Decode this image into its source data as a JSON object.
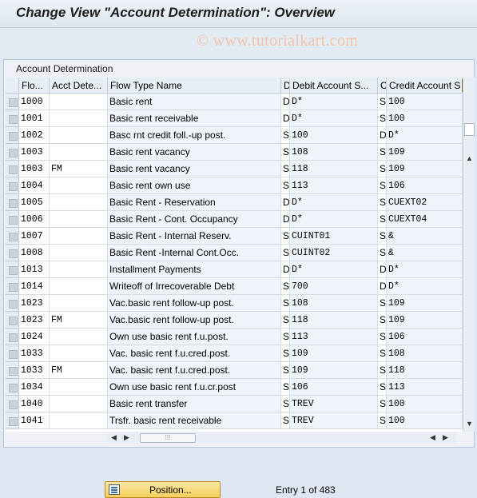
{
  "header": {
    "title": "Change View \"Account Determination\": Overview"
  },
  "watermark": "© www.tutorialkart.com",
  "panel": {
    "title": "Account Determination"
  },
  "table": {
    "columns": [
      "Flo...",
      "Acct Dete...",
      "Flow Type Name",
      "D",
      "Debit Account S...",
      "C",
      "Credit Account S"
    ],
    "rows": [
      [
        "1000",
        "",
        "Basic rent",
        "D",
        "D*",
        "S",
        "100"
      ],
      [
        "1001",
        "",
        "Basic rent receivable",
        "D",
        "D*",
        "S",
        "100"
      ],
      [
        "1002",
        "",
        "Basc rnt credit foll.-up post.",
        "S",
        "100",
        "D",
        "D*"
      ],
      [
        "1003",
        "",
        "Basic rent vacancy",
        "S",
        "108",
        "S",
        "109"
      ],
      [
        "1003",
        "FM",
        "Basic rent vacancy",
        "S",
        "118",
        "S",
        "109"
      ],
      [
        "1004",
        "",
        "Basic rent own use",
        "S",
        "113",
        "S",
        "106"
      ],
      [
        "1005",
        "",
        "Basic Rent - Reservation",
        "D",
        "D*",
        "S",
        "CUEXT02"
      ],
      [
        "1006",
        "",
        "Basic Rent - Cont. Occupancy",
        "D",
        "D*",
        "S",
        "CUEXT04"
      ],
      [
        "1007",
        "",
        "Basic Rent - Internal Reserv.",
        "S",
        "CUINT01",
        "S",
        "&"
      ],
      [
        "1008",
        "",
        "Basic Rent -Internal Cont.Occ.",
        "S",
        "CUINT02",
        "S",
        "&"
      ],
      [
        "1013",
        "",
        "Installment Payments",
        "D",
        "D*",
        "D",
        "D*"
      ],
      [
        "1014",
        "",
        "Writeoff of Irrecoverable Debt",
        "S",
        "700",
        "D",
        "D*"
      ],
      [
        "1023",
        "",
        "Vac.basic rent follow-up post.",
        "S",
        "108",
        "S",
        "109"
      ],
      [
        "1023",
        "FM",
        "Vac.basic rent follow-up post.",
        "S",
        "118",
        "S",
        "109"
      ],
      [
        "1024",
        "",
        "Own use basic rent f.u.post.",
        "S",
        "113",
        "S",
        "106"
      ],
      [
        "1033",
        "",
        "Vac. basic rent f.u.cred.post.",
        "S",
        "109",
        "S",
        "108"
      ],
      [
        "1033",
        "FM",
        "Vac. basic rent f.u.cred.post.",
        "S",
        "109",
        "S",
        "118"
      ],
      [
        "1034",
        "",
        "Own use basic rent f.u.cr.post",
        "S",
        "106",
        "S",
        "113"
      ],
      [
        "1040",
        "",
        "Basic rent transfer",
        "S",
        "TREV",
        "S",
        "100"
      ],
      [
        "1041",
        "",
        "Trsfr. basic rent receivable",
        "S",
        "TREV",
        "S",
        "100"
      ]
    ]
  },
  "footer": {
    "position_button": "Position...",
    "entry_text": "Entry 1 of 483"
  },
  "colors": {
    "title_bg": "#eef3f8",
    "grid_header": "#e7eef5",
    "button": "#f5cf5a"
  }
}
